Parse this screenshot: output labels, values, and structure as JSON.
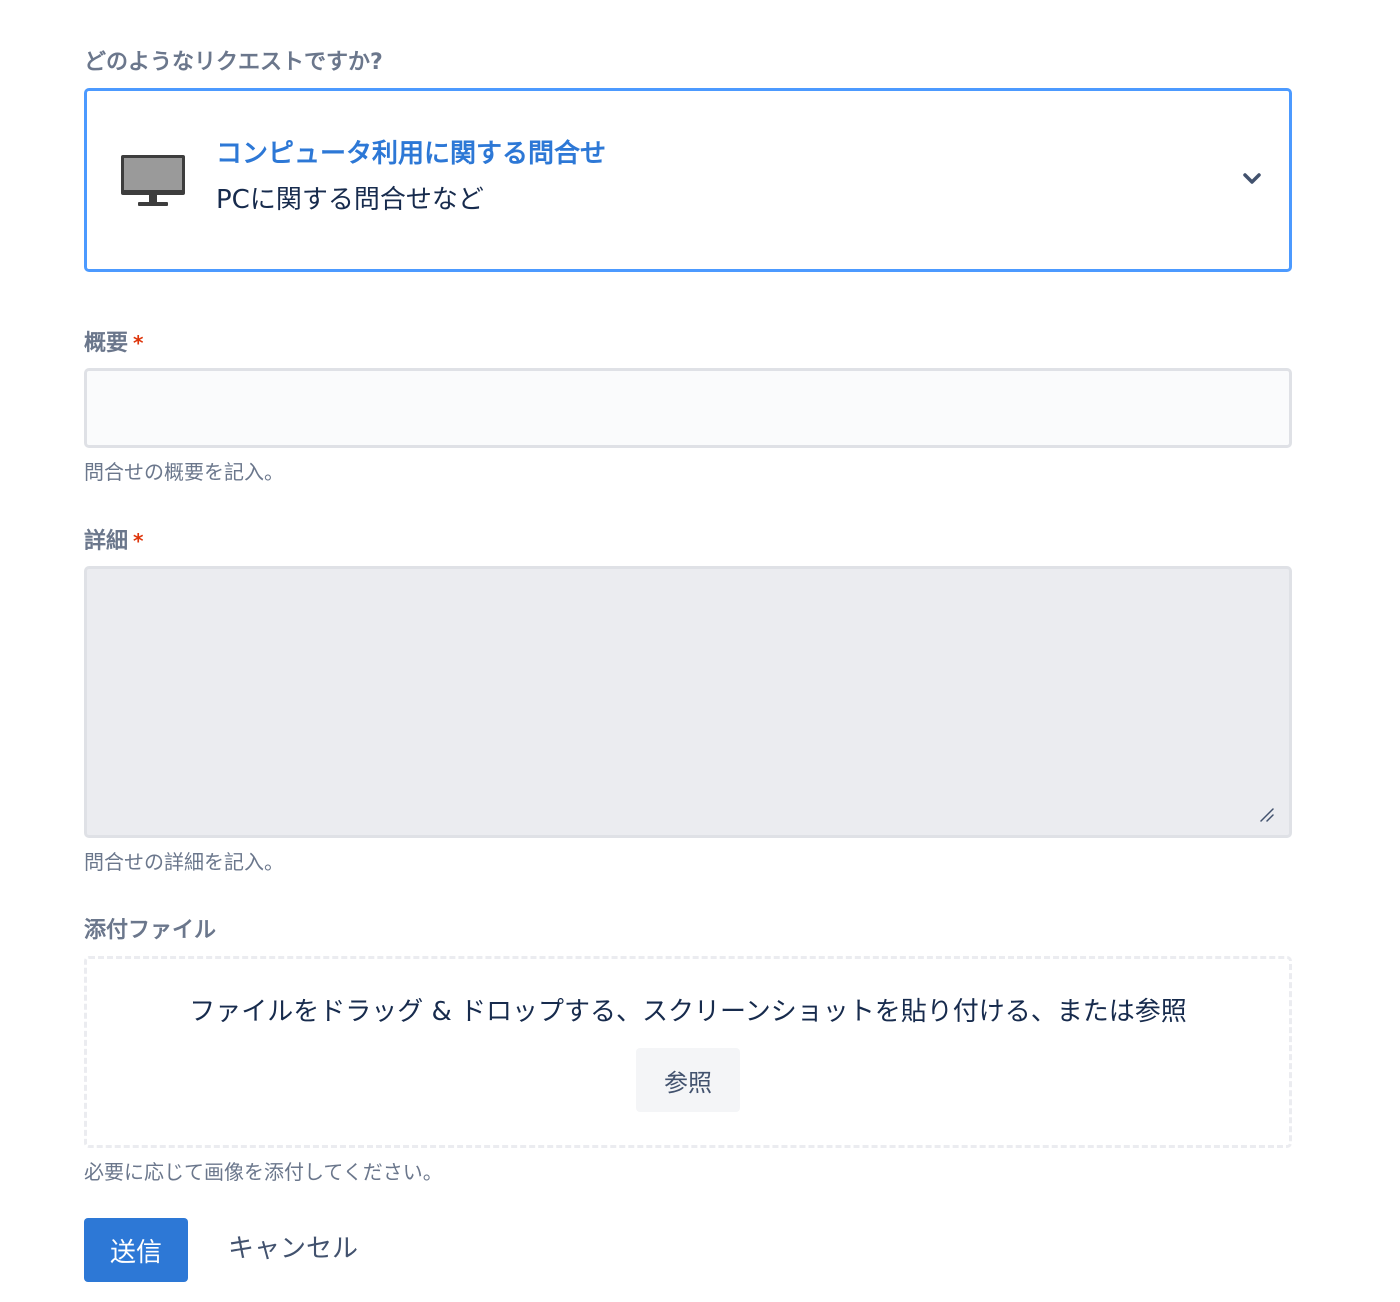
{
  "request_type": {
    "question": "どのようなリクエストですか?",
    "selected_title": "コンピュータ利用に関する問合せ",
    "selected_description": "PCに関する問合せなど",
    "icon": "monitor-icon",
    "accent_color": "#2d78d6"
  },
  "summary": {
    "label": "概要",
    "required_mark": "*",
    "value": "",
    "help": "問合せの概要を記入。"
  },
  "details": {
    "label": "詳細",
    "required_mark": "*",
    "value": "",
    "help": "問合せの詳細を記入。"
  },
  "attachments": {
    "label": "添付ファイル",
    "dropzone_text": "ファイルをドラッグ & ドロップする、スクリーンショットを貼り付ける、または参照",
    "browse_label": "参照",
    "help": "必要に応じて画像を添付してください。"
  },
  "actions": {
    "submit_label": "送信",
    "cancel_label": "キャンセル",
    "submit_color": "#2d78d6"
  }
}
